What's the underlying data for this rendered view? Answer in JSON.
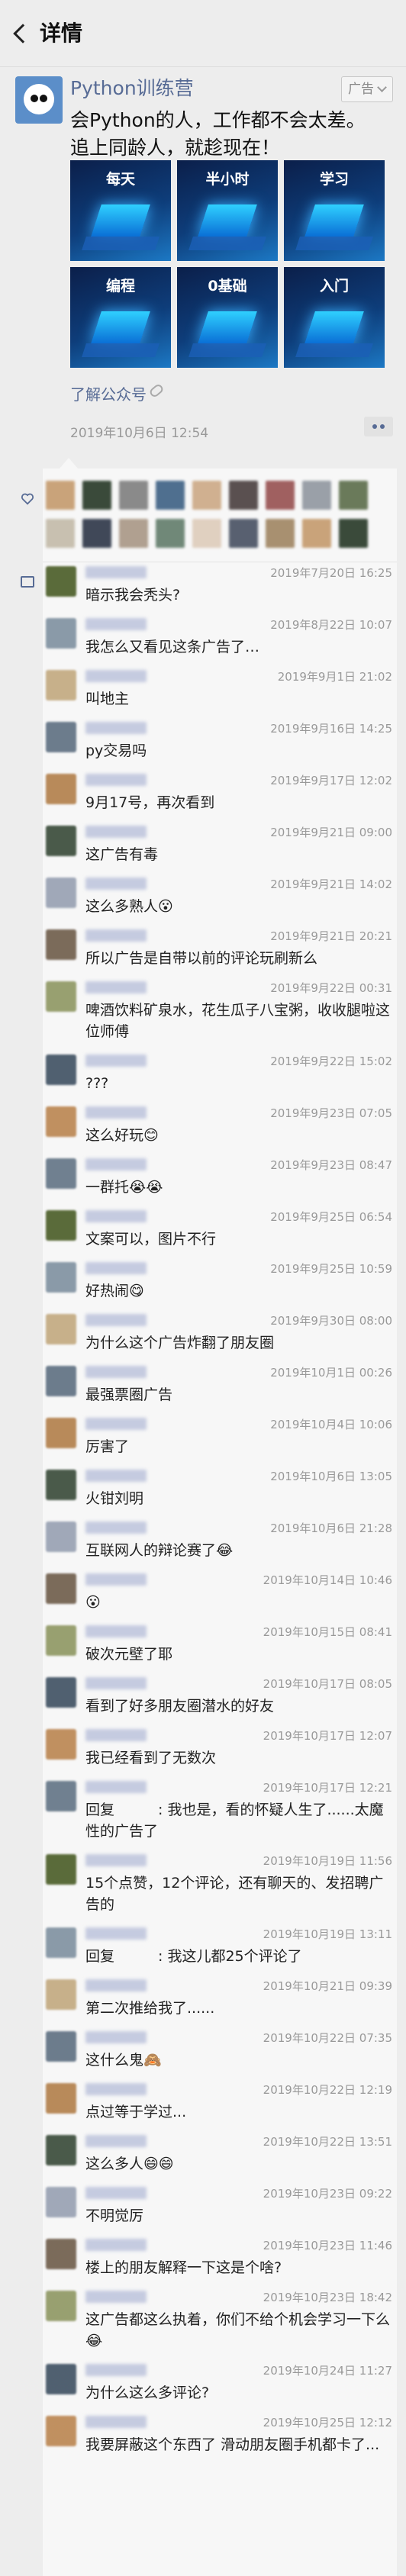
{
  "topbar": {
    "title": "详情"
  },
  "ad": {
    "account_name": "Python训练营",
    "badge_label": "广告",
    "text_line1": "会Python的人，工作都不会太差。",
    "text_line2": "追上同龄人，就趁现在！",
    "tiles": [
      "每天",
      "半小时",
      "学习",
      "编程",
      "0基础",
      "入门"
    ],
    "link_label": "了解公众号",
    "date": "2019年10月6日 12:54"
  },
  "colors": {
    "link": "#576b95",
    "background": "#ededed",
    "panel": "#f7f7f7"
  },
  "icons": {
    "back": "back-chevron-icon",
    "like": "heart-icon",
    "comment": "comment-icon",
    "more": "more-dots-icon",
    "link": "chain-link-icon"
  },
  "likes_row_count": 2,
  "comments": [
    {
      "date": "2019年7月20日 16:25",
      "text": "暗示我会秃头?"
    },
    {
      "date": "2019年8月22日 10:07",
      "text": "我怎么又看见这条广告了…"
    },
    {
      "date": "2019年9月1日 21:02",
      "text": "叫地主"
    },
    {
      "date": "2019年9月16日 14:25",
      "text": "py交易吗"
    },
    {
      "date": "2019年9月17日 12:02",
      "text": "9月17号，再次看到"
    },
    {
      "date": "2019年9月21日 09:00",
      "text": "这广告有毒"
    },
    {
      "date": "2019年9月21日 14:02",
      "text": "这么多熟人😮"
    },
    {
      "date": "2019年9月21日 20:21",
      "text": "所以广告是自带以前的评论玩刷新么"
    },
    {
      "date": "2019年9月22日 00:31",
      "text": "啤酒饮料矿泉水，花生瓜子八宝粥，收收腿啦这位师傅"
    },
    {
      "date": "2019年9月22日 15:02",
      "text": "???"
    },
    {
      "date": "2019年9月23日 07:05",
      "text": "这么好玩😊"
    },
    {
      "date": "2019年9月23日 08:47",
      "text": "一群托😭😭"
    },
    {
      "date": "2019年9月25日 06:54",
      "text": "文案可以，图片不行"
    },
    {
      "date": "2019年9月25日 10:59",
      "text": "好热闹😋"
    },
    {
      "date": "2019年9月30日 08:00",
      "text": "为什么这个广告炸翻了朋友圈"
    },
    {
      "date": "2019年10月1日 00:26",
      "text": "最强票圈广告"
    },
    {
      "date": "2019年10月4日 10:06",
      "text": "厉害了"
    },
    {
      "date": "2019年10月6日 13:05",
      "text": "火钳刘明"
    },
    {
      "date": "2019年10月6日 21:28",
      "text": "互联网人的辩论赛了😂"
    },
    {
      "date": "2019年10月14日 10:46",
      "text": "😮"
    },
    {
      "date": "2019年10月15日 08:41",
      "text": "破次元壁了耶"
    },
    {
      "date": "2019年10月17日 08:05",
      "text": "看到了好多朋友圈潜水的好友"
    },
    {
      "date": "2019年10月17日 12:07",
      "text": "我已经看到了无数次"
    },
    {
      "date": "2019年10月17日 12:21",
      "text": "回复　　　: 我也是，看的怀疑人生了......太魔性的广告了"
    },
    {
      "date": "2019年10月19日 11:56",
      "text": "15个点赞，12个评论，还有聊天的、发招聘广告的"
    },
    {
      "date": "2019年10月19日 13:11",
      "text": "回复　　　: 我这儿都25个评论了"
    },
    {
      "date": "2019年10月21日 09:39",
      "text": "第二次推给我了......"
    },
    {
      "date": "2019年10月22日 07:35",
      "text": "这什么鬼🙈"
    },
    {
      "date": "2019年10月22日 12:19",
      "text": "点过等于学过..."
    },
    {
      "date": "2019年10月22日 13:51",
      "text": "这么多人😄😄"
    },
    {
      "date": "2019年10月23日 09:22",
      "text": "不明觉厉"
    },
    {
      "date": "2019年10月23日 11:46",
      "text": "楼上的朋友解释一下这是个啥?"
    },
    {
      "date": "2019年10月23日 18:42",
      "text": "这广告都这么执着，你们不给个机会学习一下么😂"
    },
    {
      "date": "2019年10月24日 11:27",
      "text": "为什么这么多评论?"
    },
    {
      "date": "2019年10月25日 12:12",
      "text": "我要屏蔽这个东西了 滑动朋友圈手机都卡了..."
    }
  ]
}
